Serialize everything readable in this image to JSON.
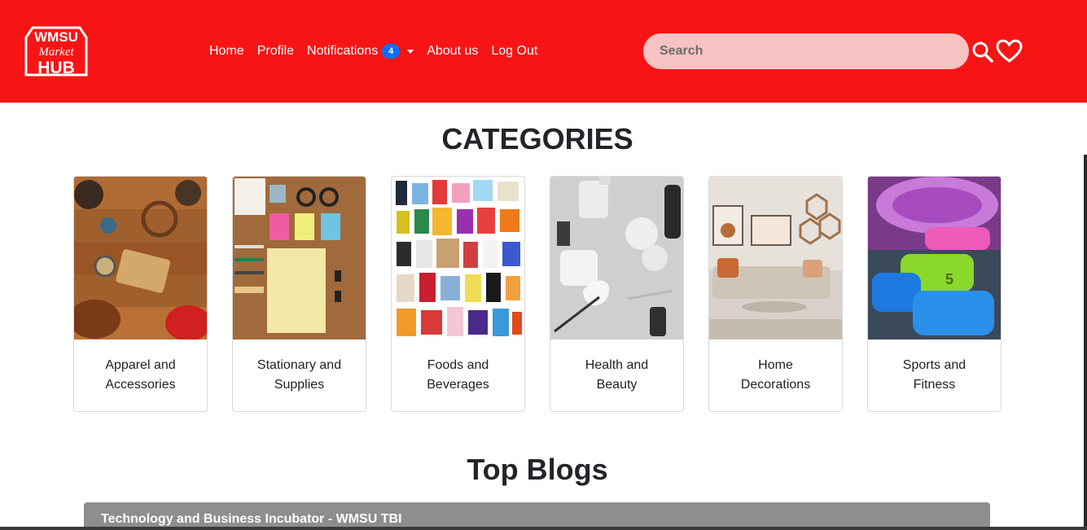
{
  "brand": {
    "logo_line1": "WMSU",
    "logo_line2": "Market",
    "logo_line3": "HUB"
  },
  "nav": {
    "home": "Home",
    "profile": "Profile",
    "notifications": "Notifications",
    "notifications_count": "4",
    "about": "About us",
    "logout": "Log Out"
  },
  "search": {
    "placeholder": "Search"
  },
  "icons": {
    "search": "search-icon",
    "favorites": "heart-icon",
    "dropdown": "caret-down-icon"
  },
  "colors": {
    "navbar": "#f81414",
    "search_bg": "#f7c2c2",
    "badge": "#0d6efd",
    "blog_bar": "#8e8e8e"
  },
  "categories": {
    "title": "CATEGORIES",
    "items": [
      {
        "line1": "Apparel and",
        "line2": "Accessories"
      },
      {
        "line1": "Stationary and",
        "line2": "Supplies"
      },
      {
        "line1": "Foods and",
        "line2": "Beverages"
      },
      {
        "line1": "Health and",
        "line2": "Beauty"
      },
      {
        "line1": "Home",
        "line2": "Decorations"
      },
      {
        "line1": "Sports and",
        "line2": "Fitness"
      }
    ]
  },
  "blogs": {
    "title": "Top Blogs",
    "first_post": "Technology and Business Incubator - WMSU TBI"
  }
}
